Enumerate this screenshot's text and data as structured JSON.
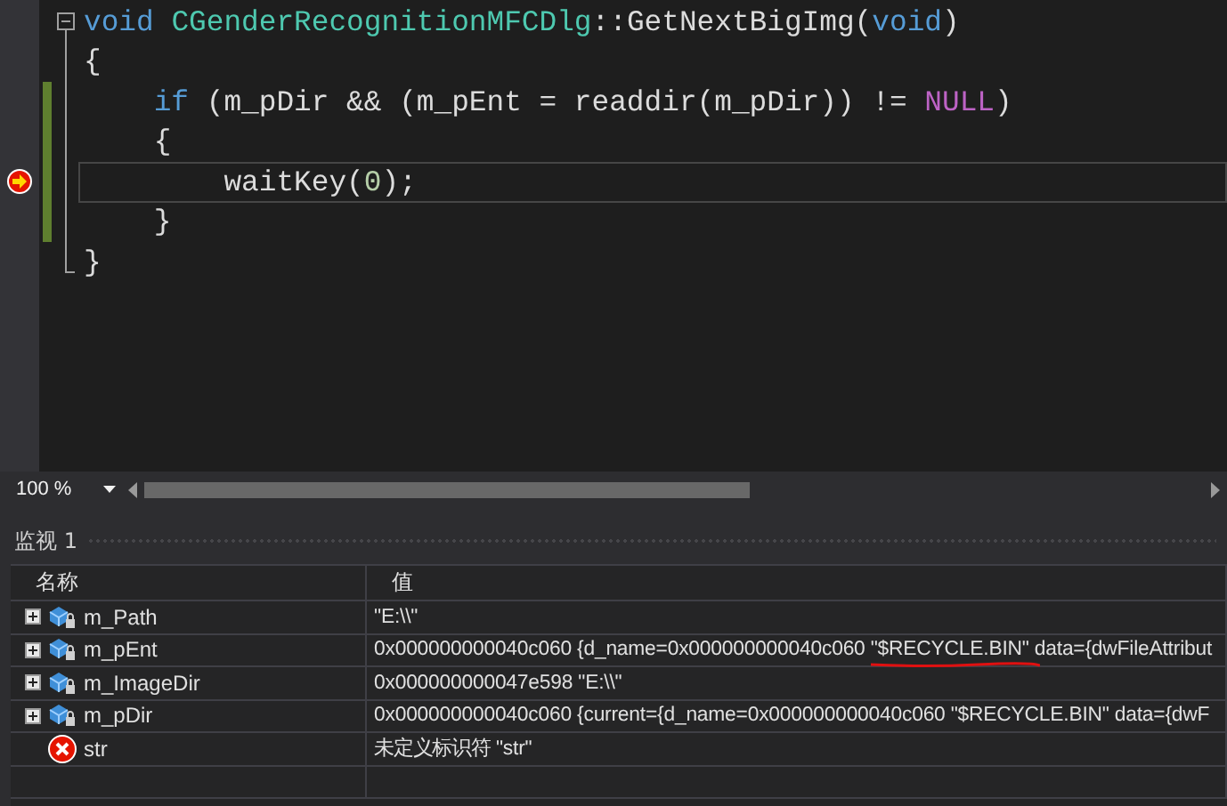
{
  "editor": {
    "lines": [
      {
        "changed": false,
        "current": false,
        "tokens": [
          {
            "kind": "keyword",
            "text": "void"
          },
          {
            "kind": "type",
            "text": " CGenderRecognitionMFCDlg"
          },
          {
            "kind": "plain",
            "text": "::GetNextBigImg("
          },
          {
            "kind": "keyword",
            "text": "void"
          },
          {
            "kind": "plain",
            "text": ")"
          }
        ]
      },
      {
        "changed": false,
        "current": false,
        "tokens": [
          {
            "kind": "plain",
            "text": "{"
          }
        ]
      },
      {
        "changed": true,
        "current": false,
        "tokens": [
          {
            "kind": "keyword",
            "text": "    if"
          },
          {
            "kind": "plain",
            "text": " (m_pDir && (m_pEnt = readdir(m_pDir)) != "
          },
          {
            "kind": "macro",
            "text": "NULL"
          },
          {
            "kind": "plain",
            "text": ")"
          }
        ]
      },
      {
        "changed": true,
        "current": false,
        "tokens": [
          {
            "kind": "plain",
            "text": "    {"
          }
        ]
      },
      {
        "changed": true,
        "current": true,
        "tokens": [
          {
            "kind": "plain",
            "text": "        waitKey("
          },
          {
            "kind": "number",
            "text": "0"
          },
          {
            "kind": "plain",
            "text": ");"
          }
        ]
      },
      {
        "changed": true,
        "current": false,
        "tokens": [
          {
            "kind": "plain",
            "text": "    }"
          }
        ]
      },
      {
        "changed": false,
        "current": false,
        "tokens": [
          {
            "kind": "plain",
            "text": "}"
          }
        ]
      }
    ]
  },
  "zoom": {
    "value": "100 %"
  },
  "watch": {
    "title": "监视 1",
    "columns": [
      "名称",
      "值"
    ],
    "rows": [
      {
        "expandable": true,
        "kind": "field",
        "name": "m_Path",
        "value": [
          {
            "text": "\"E:\\\\\"",
            "underlined": false
          }
        ]
      },
      {
        "expandable": true,
        "kind": "field",
        "name": "m_pEnt",
        "value": [
          {
            "text": "0x000000000040c060 {d_name=0x000000000040c060 ",
            "underlined": false
          },
          {
            "text": "\"$RECYCLE.BIN\"",
            "underlined": true
          },
          {
            "text": " data={dwFileAttribut",
            "underlined": false
          }
        ]
      },
      {
        "expandable": true,
        "kind": "field",
        "name": "m_ImageDir",
        "value": [
          {
            "text": "0x000000000047e598 \"E:\\\\\"",
            "underlined": false
          }
        ]
      },
      {
        "expandable": true,
        "kind": "field",
        "name": "m_pDir",
        "value": [
          {
            "text": "0x000000000040c060 {current={d_name=0x000000000040c060 \"$RECYCLE.BIN\" data={dwF",
            "underlined": false
          }
        ]
      },
      {
        "expandable": false,
        "kind": "error",
        "name": "str",
        "value": [
          {
            "text": "未定义标识符 \"str\"",
            "underlined": false
          }
        ]
      }
    ]
  }
}
